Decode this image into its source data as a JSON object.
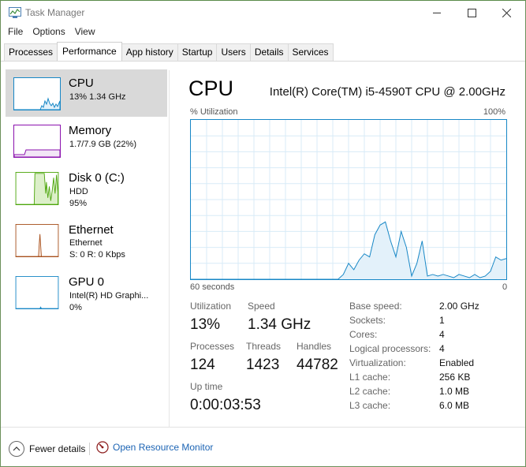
{
  "window": {
    "title": "Task Manager"
  },
  "menu": [
    "File",
    "Options",
    "View"
  ],
  "tabs": [
    "Processes",
    "Performance",
    "App history",
    "Startup",
    "Users",
    "Details",
    "Services"
  ],
  "active_tab": "Performance",
  "sidebar": [
    {
      "title": "CPU",
      "sub1": "13% 1.34 GHz",
      "sub2": "",
      "color": "#1787c6",
      "fill": "#e3f1fa",
      "level": 0.13
    },
    {
      "title": "Memory",
      "sub1": "1.7/7.9 GB (22%)",
      "sub2": "",
      "color": "#8b12ae",
      "fill": "#f2e6f6",
      "level": 0.22
    },
    {
      "title": "Disk 0 (C:)",
      "sub1": "HDD",
      "sub2": "95%",
      "color": "#4da60c",
      "fill": "#eef7e5",
      "level": 0.95
    },
    {
      "title": "Ethernet",
      "sub1": "Ethernet",
      "sub2": "S: 0 R: 0 Kbps",
      "color": "#a7501d",
      "fill": "#fcf3eb",
      "level": 0
    },
    {
      "title": "GPU 0",
      "sub1": "Intel(R) HD Graphi...",
      "sub2": "0%",
      "color": "#1787c6",
      "fill": "#e3f1fa",
      "level": 0
    }
  ],
  "main": {
    "title": "CPU",
    "model": "Intel(R) Core(TM) i5-4590T CPU @ 2.00GHz",
    "axis_left_top": "% Utilization",
    "axis_right_top": "100%",
    "axis_left_bottom": "60 seconds",
    "axis_right_bottom": "0"
  },
  "chart_data": {
    "type": "area",
    "xlabel": "60 seconds",
    "ylabel": "% Utilization",
    "ylim": [
      0,
      100
    ],
    "x": [
      60,
      59,
      58,
      57,
      56,
      55,
      54,
      53,
      52,
      51,
      50,
      49,
      48,
      47,
      46,
      45,
      44,
      43,
      42,
      41,
      40,
      39,
      38,
      37,
      36,
      35,
      34,
      33,
      32,
      31,
      30,
      29,
      28,
      27,
      26,
      25,
      24,
      23,
      22,
      21,
      20,
      19,
      18,
      17,
      16,
      15,
      14,
      13,
      12,
      11,
      10,
      9,
      8,
      7,
      6,
      5,
      4,
      3,
      2,
      1,
      0
    ],
    "values": [
      0,
      0,
      0,
      0,
      0,
      0,
      0,
      0,
      0,
      0,
      0,
      0,
      0,
      0,
      0,
      0,
      0,
      0,
      0,
      0,
      0,
      0,
      0,
      0,
      0,
      0,
      0,
      0,
      0,
      3,
      10,
      6,
      12,
      16,
      14,
      28,
      34,
      36,
      24,
      14,
      30,
      20,
      2,
      10,
      24,
      2,
      3,
      2,
      3,
      2,
      1,
      3,
      2,
      1,
      3,
      1,
      2,
      5,
      14,
      12,
      13
    ]
  },
  "stats": {
    "utilization_label": "Utilization",
    "utilization": "13%",
    "speed_label": "Speed",
    "speed": "1.34 GHz",
    "processes_label": "Processes",
    "processes": "124",
    "threads_label": "Threads",
    "threads": "1423",
    "handles_label": "Handles",
    "handles": "44782",
    "uptime_label": "Up time",
    "uptime": "0:00:03:53"
  },
  "specs": [
    {
      "label": "Base speed:",
      "value": "2.00 GHz"
    },
    {
      "label": "Sockets:",
      "value": "1"
    },
    {
      "label": "Cores:",
      "value": "4"
    },
    {
      "label": "Logical processors:",
      "value": "4"
    },
    {
      "label": "Virtualization:",
      "value": "Enabled"
    },
    {
      "label": "L1 cache:",
      "value": "256 KB"
    },
    {
      "label": "L2 cache:",
      "value": "1.0 MB"
    },
    {
      "label": "L3 cache:",
      "value": "6.0 MB"
    }
  ],
  "footer": {
    "fewer_details": "Fewer details",
    "resource_monitor": "Open Resource Monitor"
  },
  "colors": {
    "cpu_accent": "#1787c6",
    "link": "#1c64b4"
  }
}
